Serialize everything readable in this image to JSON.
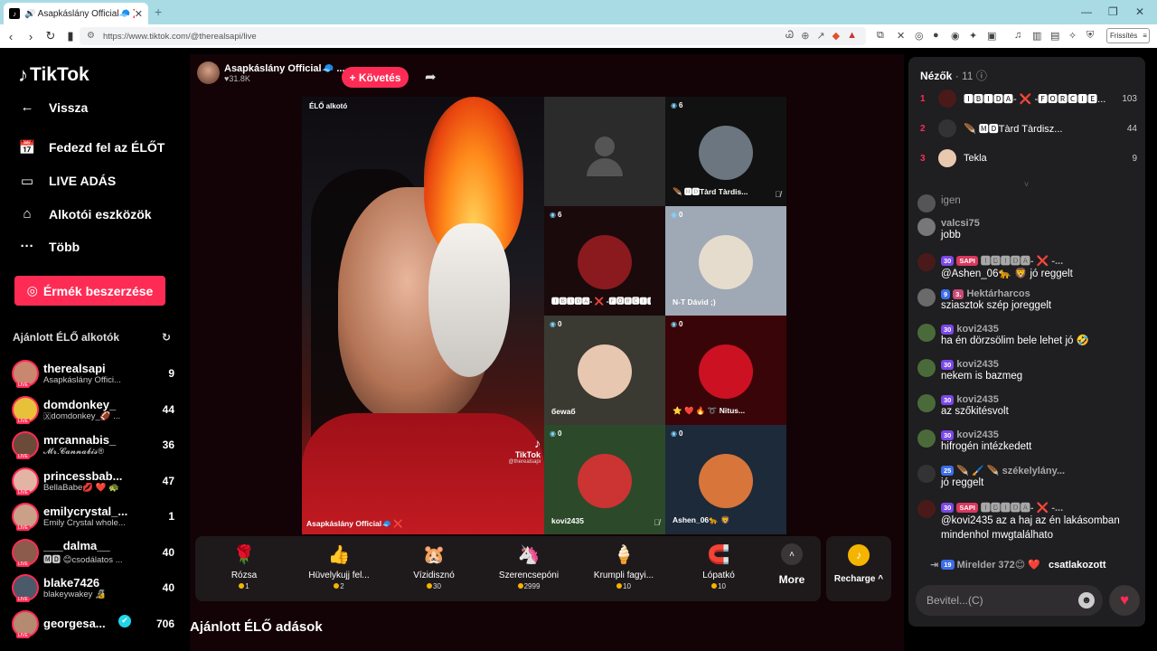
{
  "browser": {
    "tab_title": "🔊 Asapkáslány Official🧢 ❌ (C",
    "url": "https://www.tiktok.com/@therealsapi/live",
    "refresh_label": "Frissítés"
  },
  "sidebar": {
    "logo": "TikTok",
    "nav": [
      {
        "label": "Vissza",
        "icon": "arrow-left-icon",
        "glyph": "←"
      },
      {
        "label": "Fedezd fel az ÉLŐT",
        "icon": "calendar-live-icon",
        "glyph": "📅"
      },
      {
        "label": "LIVE ADÁS",
        "icon": "camera-icon",
        "glyph": "▭"
      },
      {
        "label": "Alkotói eszközök",
        "icon": "creator-tools-icon",
        "glyph": "⌂"
      },
      {
        "label": "Több",
        "icon": "more-dots-icon",
        "glyph": "···"
      }
    ],
    "coins_button": "Érmék beszerzése",
    "recommended_title": "Ajánlott ÉLŐ alkotók",
    "recommended": [
      {
        "name": "therealsapi",
        "sub": "Asapkáslány Offici...",
        "count": "9",
        "color": "#c98770"
      },
      {
        "name": "domdonkey_",
        "sub": "🇽domdonkey_🏈 ...",
        "count": "44",
        "color": "#e8c13a"
      },
      {
        "name": "mrcannabis_",
        "sub": "𝓜𝓻.𝓒𝓪𝓷𝓷𝓪𝓫𝓲𝓼®",
        "count": "36",
        "color": "#6b4a3a"
      },
      {
        "name": "princessbab...",
        "sub": "BellaBabe💋 ❤️ 🐢",
        "count": "47",
        "color": "#e3b3a5"
      },
      {
        "name": "emilycrystal_...",
        "sub": "Emily Crystal whole...",
        "count": "1",
        "color": "#caa089"
      },
      {
        "name": "___dalma__",
        "sub": "🅼🅳 😊csodálatos ...",
        "count": "40",
        "color": "#8b5b4b"
      },
      {
        "name": "blake7426",
        "sub": "blakeywakey 🔏",
        "count": "40",
        "color": "#4a5a6a"
      },
      {
        "name": "georgesa...",
        "sub": "",
        "count": "706",
        "color": "#b48a70"
      }
    ]
  },
  "main": {
    "host_name": "Asapkáslány Official🧢 ...",
    "host_likes": "♥31.8K",
    "follow_button": "+ Követés",
    "host_tag": "ÉLŐ alkotó",
    "watermark": "TikTok",
    "watermark_handle": "@therealsapi",
    "host_caption": "Asapkáslány Official🧢 ❌",
    "guests": [
      {
        "label": "",
        "count": "",
        "color": "#2b2b2b"
      },
      {
        "label": "🪶 🅼🅳Tàrd Tàrdis...",
        "count": "6",
        "color": "#111"
      },
      {
        "label": "🅸🅱🅸🅳🅰- ❌ -🅵🅾🆁🅲🅸🅴...",
        "count": "6",
        "color": "#1a0a0c"
      },
      {
        "label": "N-T Dávid ;)",
        "count": "0",
        "color": "#9fa8b5"
      },
      {
        "label": "бewaб",
        "count": "0",
        "color": "#3a3a33"
      },
      {
        "label": "⭐ ❤️ 🔥 ➰ Nitus...",
        "count": "0",
        "color": "#3a0508"
      },
      {
        "label": "kovi2435",
        "count": "0",
        "color": "#2c4a2a"
      },
      {
        "label": "Ashen_06🐆 🦁",
        "count": "0",
        "color": "#1c2a3a"
      }
    ],
    "gifts": [
      {
        "name": "Rózsa",
        "price": "1",
        "icon": "rose-icon",
        "glyph": "🌹"
      },
      {
        "name": "Hüvelykujj fel...",
        "price": "2",
        "icon": "thumbs-up-icon",
        "glyph": "👍"
      },
      {
        "name": "Vízidisznó",
        "price": "30",
        "icon": "capybara-icon",
        "glyph": "🐹"
      },
      {
        "name": "Szerencsepóni",
        "price": "2999",
        "icon": "pony-icon",
        "glyph": "🦄"
      },
      {
        "name": "Krumpli fagyi...",
        "price": "10",
        "icon": "ice-cream-icon",
        "glyph": "🍦"
      },
      {
        "name": "Lópatkó",
        "price": "10",
        "icon": "horseshoe-icon",
        "glyph": "🧲"
      }
    ],
    "more_label": "More",
    "recharge_label": "Recharge ^",
    "recommended_live_title": "Ajánlott ÉLŐ adások"
  },
  "chat": {
    "viewers_title": "Nézők",
    "viewers_count": "· 11",
    "top_viewers": [
      {
        "rank": "1",
        "name": "🅸🅱🅸🅳🅰- ❌ -🅵🅾🆁🅲🅸🅴...",
        "score": "103",
        "color": "#4a1a1a"
      },
      {
        "rank": "2",
        "name": "🪶 🅼🅳Tàrd Tàrdisz...",
        "score": "44",
        "color": "#333"
      },
      {
        "rank": "3",
        "name": "Tekla",
        "score": "9",
        "color": "#e8c9b0"
      }
    ],
    "messages": [
      {
        "user": "",
        "badges": [],
        "text": "igen",
        "color": "#555"
      },
      {
        "user": "valcsi75",
        "badges": [],
        "text": "jobb",
        "color": "#777"
      },
      {
        "user": "🅸🅱🅸🅳🅰- ❌ -...",
        "badges": [
          "30",
          "SAPI"
        ],
        "text": "@Ashen_06🐆 🦁 jó reggelt",
        "color": "#4a1a1a"
      },
      {
        "user": "Hektárharcos",
        "badges": [
          "9",
          "3."
        ],
        "text": "sziasztok szép joreggelt",
        "color": "#6a6a6a"
      },
      {
        "user": "kovi2435",
        "badges": [
          "30"
        ],
        "text": "ha én dörzsölim bele lehet jó 🤣",
        "color": "#4a6a3a"
      },
      {
        "user": "kovi2435",
        "badges": [
          "30"
        ],
        "text": "nekem is bazmeg",
        "color": "#4a6a3a"
      },
      {
        "user": "kovi2435",
        "badges": [
          "30"
        ],
        "text": "az szőkitésvolt",
        "color": "#4a6a3a"
      },
      {
        "user": "kovi2435",
        "badges": [
          "30"
        ],
        "text": "hifrogén intézkedett",
        "color": "#4a6a3a"
      },
      {
        "user": "🪶 🖌️ 🪶 székelylány...",
        "badges": [
          "25"
        ],
        "text": "jó reggelt",
        "color": "#333"
      },
      {
        "user": "🅸🅱🅸🅳🅰- ❌ -...",
        "badges": [
          "30",
          "SAPI"
        ],
        "text": "@kovi2435 az a haj az én lakásomban mindenhol mwgtalálhato",
        "color": "#4a1a1a"
      }
    ],
    "join_badge": "19",
    "join_text": "Mirelder 372😊 ❤️",
    "join_action": "csatlakozott",
    "input_placeholder": "Bevitel...(C)"
  },
  "colors": {
    "accent": "#fe2c55",
    "panel": "#1f1e20",
    "main_bg": "#130306"
  }
}
